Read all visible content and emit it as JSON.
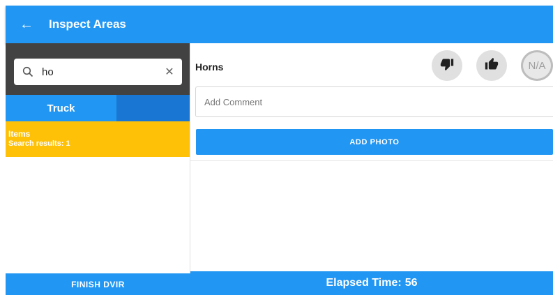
{
  "appbar": {
    "title": "Inspect Areas",
    "back_icon": "arrow-left-icon",
    "color": "#2196f3"
  },
  "search": {
    "value": "ho",
    "search_icon": "search-icon",
    "clear_icon": "close-icon"
  },
  "tabs": [
    {
      "label": "Truck",
      "selected": true
    },
    {
      "label": "",
      "selected": false
    }
  ],
  "results": {
    "heading": "Items",
    "summary": "Search results: 1"
  },
  "inspection_item": {
    "name": "Horns",
    "options": [
      {
        "name": "defect",
        "icon": "thumbs-down-icon"
      },
      {
        "name": "ok",
        "icon": "thumbs-up-icon"
      },
      {
        "name": "not-applicable",
        "label": "N/A"
      }
    ],
    "comment_placeholder": "Add Comment",
    "add_photo_label": "ADD PHOTO"
  },
  "footer": {
    "finish_label": "FINISH DVIR",
    "elapsed_label": "Elapsed Time:",
    "elapsed_value": "56"
  },
  "colors": {
    "primary": "#2196f3",
    "primary_dark": "#1976d2",
    "search_band": "#424242",
    "results": "#ffc107"
  }
}
